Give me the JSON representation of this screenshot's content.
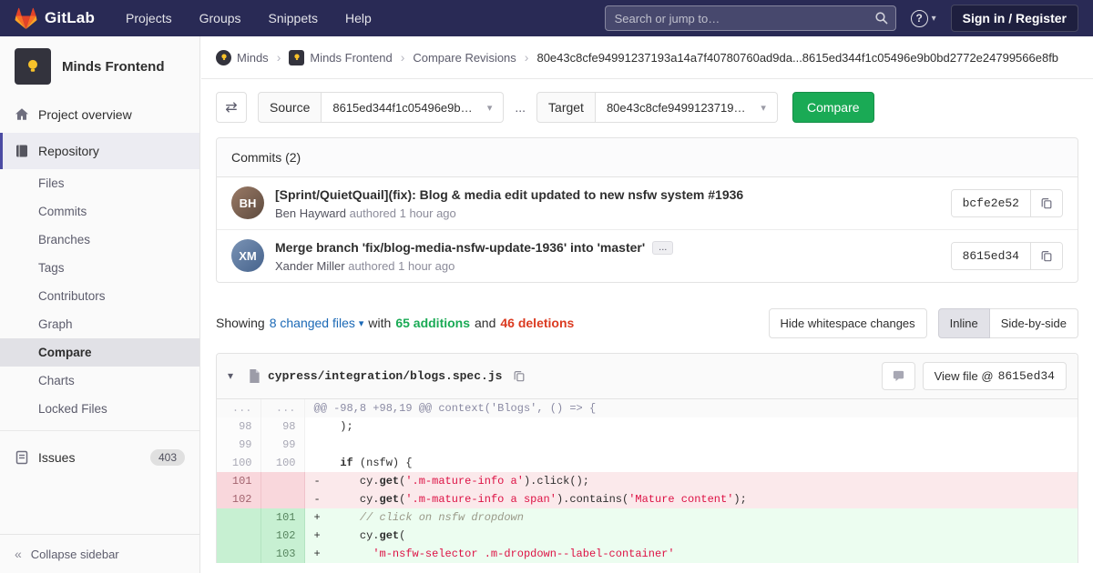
{
  "icons": {
    "caret_down": "▾",
    "breadcrumb_separator": "›",
    "collapse": "«",
    "swap": "⇄",
    "help": "?"
  },
  "navbar": {
    "brand": "GitLab",
    "links": [
      {
        "label": "Projects"
      },
      {
        "label": "Groups"
      },
      {
        "label": "Snippets"
      },
      {
        "label": "Help"
      }
    ],
    "search_placeholder": "Search or jump to…",
    "sign_in_label": "Sign in / Register"
  },
  "sidebar": {
    "project_name": "Minds Frontend",
    "overview_label": "Project overview",
    "repository_label": "Repository",
    "repo_items": [
      "Files",
      "Commits",
      "Branches",
      "Tags",
      "Contributors",
      "Graph",
      "Compare",
      "Charts",
      "Locked Files"
    ],
    "issues_label": "Issues",
    "issues_count": "403",
    "collapse_label": "Collapse sidebar"
  },
  "breadcrumb": {
    "group": "Minds",
    "project": "Minds Frontend",
    "section": "Compare Revisions",
    "current": "80e43c8cfe94991237193a14a7f40780760ad9da...8615ed344f1c05496e9b0bd2772e24799566e8fb"
  },
  "compare_form": {
    "source_label": "Source",
    "source_value": "8615ed344f1c05496e9b…",
    "separator": "...",
    "target_label": "Target",
    "target_value": "80e43c8cfe9499123719…",
    "submit_label": "Compare"
  },
  "commits": {
    "header": "Commits (2)",
    "items": [
      {
        "title": "[Sprint/QuietQuail](fix): Blog & media edit updated to new nsfw system #1936",
        "author": "Ben Hayward",
        "meta": "authored 1 hour ago",
        "sha": "bcfe2e52",
        "initials": "BH"
      },
      {
        "title": "Merge branch 'fix/blog-media-nsfw-update-1936' into 'master'",
        "expander": "...",
        "author": "Xander Miller",
        "meta": "authored 1 hour ago",
        "sha": "8615ed34",
        "initials": "XM"
      }
    ]
  },
  "diff_summary": {
    "showing": "Showing",
    "files_link": "8 changed files",
    "with": "with",
    "additions": "65 additions",
    "and": "and",
    "deletions": "46 deletions",
    "whitespace_button": "Hide whitespace changes",
    "inline_button": "Inline",
    "side_by_side_button": "Side-by-side"
  },
  "diff_file": {
    "path": "cypress/integration/blogs.spec.js",
    "view_file_label": "View file @",
    "view_file_sha": "8615ed34",
    "lines": [
      {
        "type": "match",
        "old": "...",
        "new": "...",
        "segments": [
          {
            "cls": "m",
            "text": "@@ -98,8 +98,19 @@ context('Blogs', () => {"
          }
        ]
      },
      {
        "type": "context",
        "old": "98",
        "new": "98",
        "segments": [
          {
            "cls": "p",
            "text": "    );"
          }
        ]
      },
      {
        "type": "context",
        "old": "99",
        "new": "99",
        "segments": [
          {
            "cls": "p",
            "text": ""
          }
        ]
      },
      {
        "type": "context",
        "old": "100",
        "new": "100",
        "segments": [
          {
            "cls": "p",
            "text": "    "
          },
          {
            "cls": "k",
            "text": "if"
          },
          {
            "cls": "p",
            "text": " (nsfw) {"
          }
        ]
      },
      {
        "type": "removed",
        "old": "101",
        "new": "",
        "segments": [
          {
            "cls": "p",
            "text": "-      cy."
          },
          {
            "cls": "k",
            "text": "get"
          },
          {
            "cls": "p",
            "text": "("
          },
          {
            "cls": "s",
            "text": "'.m-mature-info a'"
          },
          {
            "cls": "p",
            "text": ").click();"
          }
        ]
      },
      {
        "type": "removed",
        "old": "102",
        "new": "",
        "segments": [
          {
            "cls": "p",
            "text": "-      cy."
          },
          {
            "cls": "k",
            "text": "get"
          },
          {
            "cls": "p",
            "text": "("
          },
          {
            "cls": "s",
            "text": "'.m-mature-info a span'"
          },
          {
            "cls": "p",
            "text": ").contains("
          },
          {
            "cls": "s",
            "text": "'Mature content'"
          },
          {
            "cls": "p",
            "text": ");"
          }
        ]
      },
      {
        "type": "added",
        "old": "",
        "new": "101",
        "segments": [
          {
            "cls": "p",
            "text": "+      "
          },
          {
            "cls": "c",
            "text": "// click on nsfw dropdown"
          }
        ]
      },
      {
        "type": "added",
        "old": "",
        "new": "102",
        "segments": [
          {
            "cls": "p",
            "text": "+      cy."
          },
          {
            "cls": "k",
            "text": "get"
          },
          {
            "cls": "p",
            "text": "("
          }
        ]
      },
      {
        "type": "added",
        "old": "",
        "new": "103",
        "segments": [
          {
            "cls": "p",
            "text": "+        "
          },
          {
            "cls": "s",
            "text": "'m-nsfw-selector .m-dropdown--label-container'"
          }
        ]
      }
    ]
  }
}
